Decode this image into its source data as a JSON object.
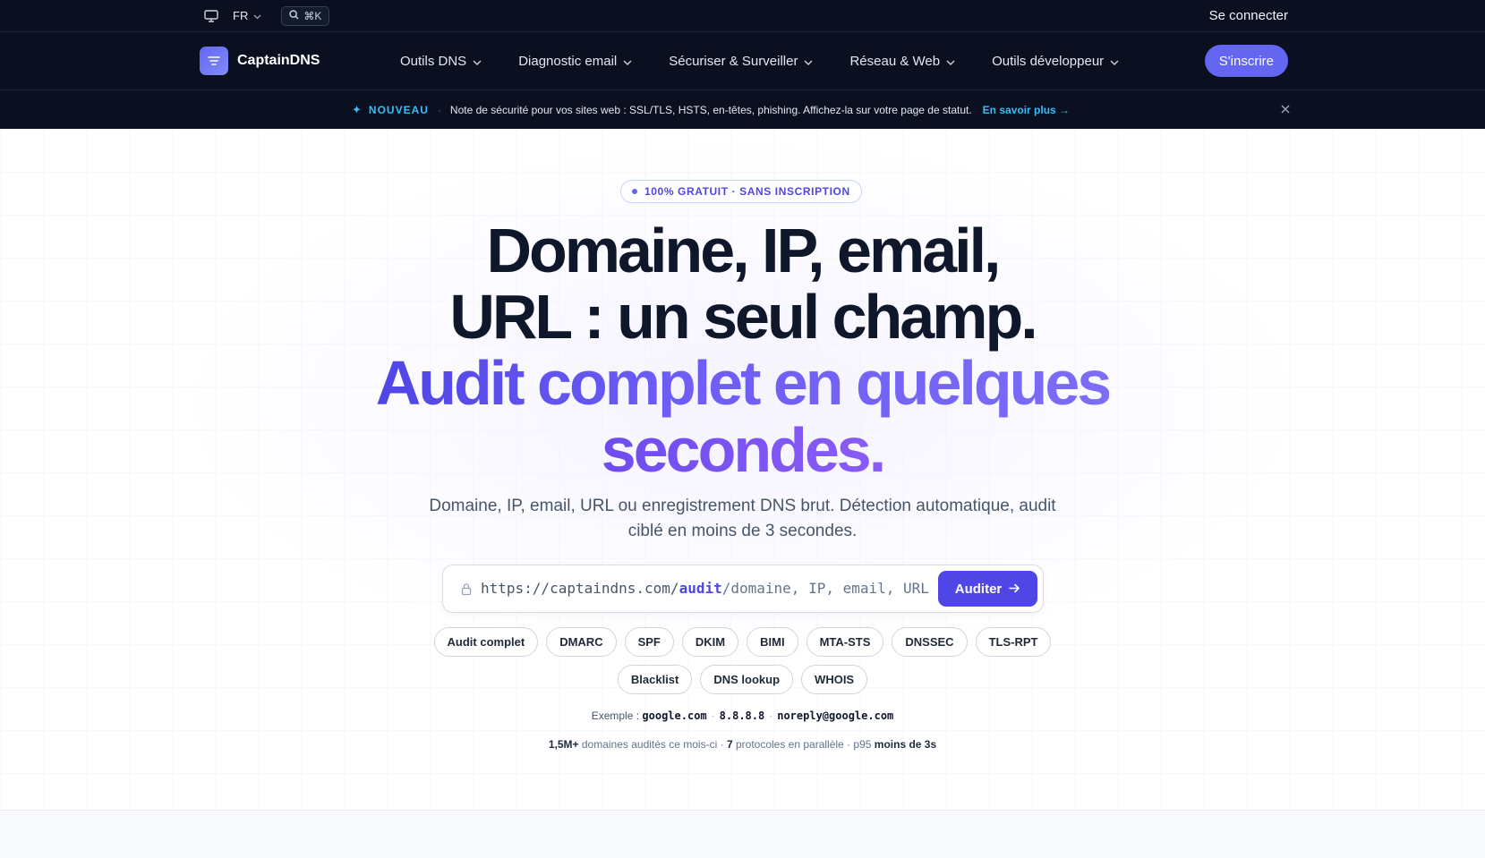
{
  "topbar": {
    "monitor_icon": "monitor-icon",
    "lang": "FR",
    "shortcut": "⌘K",
    "signin": "Se connecter"
  },
  "nav": {
    "brand": "CaptainDNS",
    "items": [
      {
        "label": "Outils DNS"
      },
      {
        "label": "Diagnostic email"
      },
      {
        "label": "Sécuriser & Surveiller"
      },
      {
        "label": "Réseau & Web"
      },
      {
        "label": "Outils développeur"
      }
    ],
    "cta": "S'inscrire"
  },
  "announcement": {
    "tag": "NOUVEAU",
    "text": "Note de sécurité pour vos sites web : SSL/TLS, HSTS, en-têtes, phishing. Affichez-la sur votre page de statut.",
    "link": "En savoir plus →"
  },
  "hero": {
    "badge": "100% GRATUIT · SANS INSCRIPTION",
    "title_line1": "Domaine, IP, email,",
    "title_line2": "URL : un seul champ.",
    "title_line3": "Audit complet en quelques",
    "title_line4": "secondes.",
    "subtitle_line1": "Domaine, IP, email, URL ou enregistrement DNS brut. Détection automatique, audit",
    "subtitle_line2": "ciblé en moins de 3 secondes."
  },
  "search": {
    "prefix": "https://captaindns.com/",
    "accent": "audit",
    "placeholder": "/domaine, IP, email, URL",
    "button": "Auditer"
  },
  "chips_row1": [
    "Audit complet",
    "DMARC",
    "SPF",
    "DKIM",
    "BIMI",
    "MTA-STS",
    "DNSSEC",
    "TLS-RPT"
  ],
  "chips_row2": [
    "Blacklist",
    "DNS lookup",
    "WHOIS"
  ],
  "examples": {
    "label": "Exemple :",
    "items": [
      "google.com",
      "8.8.8.8",
      "noreply@google.com"
    ]
  },
  "stats": {
    "a_value": "1,5M+",
    "a_text": "domaines audités ce mois-ci",
    "b_value": "7",
    "b_text": "protocoles en parallèle",
    "c_prefix": "p95",
    "c_value": "moins de 3s"
  },
  "colors": {
    "nav_bg": "#0b1020",
    "accent": "#4f46e5",
    "cta": "#6366f1",
    "announcement_accent": "#38bdf8"
  }
}
